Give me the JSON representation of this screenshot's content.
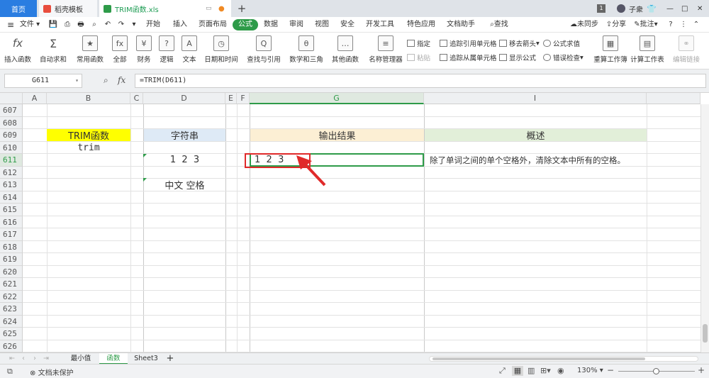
{
  "titlebar": {
    "tabs": [
      {
        "label": "首页"
      },
      {
        "label": "稻壳模板"
      },
      {
        "label": "TRIM函数.xls"
      }
    ],
    "plus": "+",
    "page_badge": "1",
    "user": "子衆",
    "window_controls": [
      "—",
      "□",
      "✕"
    ]
  },
  "menubar": {
    "file": "文件",
    "items": [
      "开始",
      "插入",
      "页面布局",
      "公式",
      "数据",
      "审阅",
      "视图",
      "安全",
      "开发工具",
      "特色应用",
      "文档助手"
    ],
    "search": "查找",
    "sync": "未同步",
    "share": "分享",
    "comment": "批注",
    "help": "?"
  },
  "ribbon": {
    "buttons": [
      {
        "label": "插入函数",
        "icon": "fx"
      },
      {
        "label": "自动求和",
        "icon": "Σ"
      },
      {
        "label": "常用函数",
        "icon": "★"
      },
      {
        "label": "全部",
        "icon": "fx"
      },
      {
        "label": "财务",
        "icon": "¥"
      },
      {
        "label": "逻辑",
        "icon": "?"
      },
      {
        "label": "文本",
        "icon": "A"
      },
      {
        "label": "日期和时间",
        "icon": "◷"
      },
      {
        "label": "查找与引用",
        "icon": "Q"
      },
      {
        "label": "数学和三角",
        "icon": "θ"
      },
      {
        "label": "其他函数",
        "icon": "…"
      },
      {
        "label": "名称管理器",
        "icon": "≡"
      }
    ],
    "small": [
      "指定",
      "粘贴",
      "追踪引用单元格",
      "追踪从属单元格",
      "移去箭头",
      "显示公式",
      "公式求值",
      "错误检查"
    ],
    "right_buttons": [
      {
        "label": "重算工作簿",
        "icon": "▦"
      },
      {
        "label": "计算工作表",
        "icon": "▤"
      },
      {
        "label": "编辑链接",
        "icon": "⚭"
      }
    ]
  },
  "formula_bar": {
    "cell_ref": "G611",
    "fx_label": "fx",
    "formula": "=TRIM(D611)"
  },
  "columns": [
    "A",
    "B",
    "C",
    "D",
    "E",
    "F",
    "G",
    "I"
  ],
  "rows": [
    "607",
    "608",
    "609",
    "610",
    "611",
    "612",
    "613",
    "614",
    "615",
    "616",
    "617",
    "618",
    "619",
    "620",
    "621",
    "622",
    "623",
    "624",
    "625",
    "626"
  ],
  "cells": {
    "b609": "TRIM函数",
    "b610": "trim",
    "d609": "字符串",
    "d611": "1  2  3",
    "d613": "中文 空格",
    "g609": "输出结果",
    "g611": "1  2  3",
    "i609": "概述",
    "i611": "除了单词之间的单个空格外，清除文本中所有的空格。"
  },
  "colors": {
    "yellow": "#ffff00",
    "blue_header": "#deeaf6",
    "orange_header": "#fcefd4",
    "green_header": "#e2efd9",
    "highlight_red": "#e02a2a",
    "selection_green": "#2e9b49"
  },
  "sheets": {
    "tabs": [
      "最小值",
      "函数",
      "Sheet3"
    ],
    "active": "函数",
    "add": "+"
  },
  "statusbar": {
    "doc_protect": "文档未保护",
    "zoom": "130%"
  }
}
